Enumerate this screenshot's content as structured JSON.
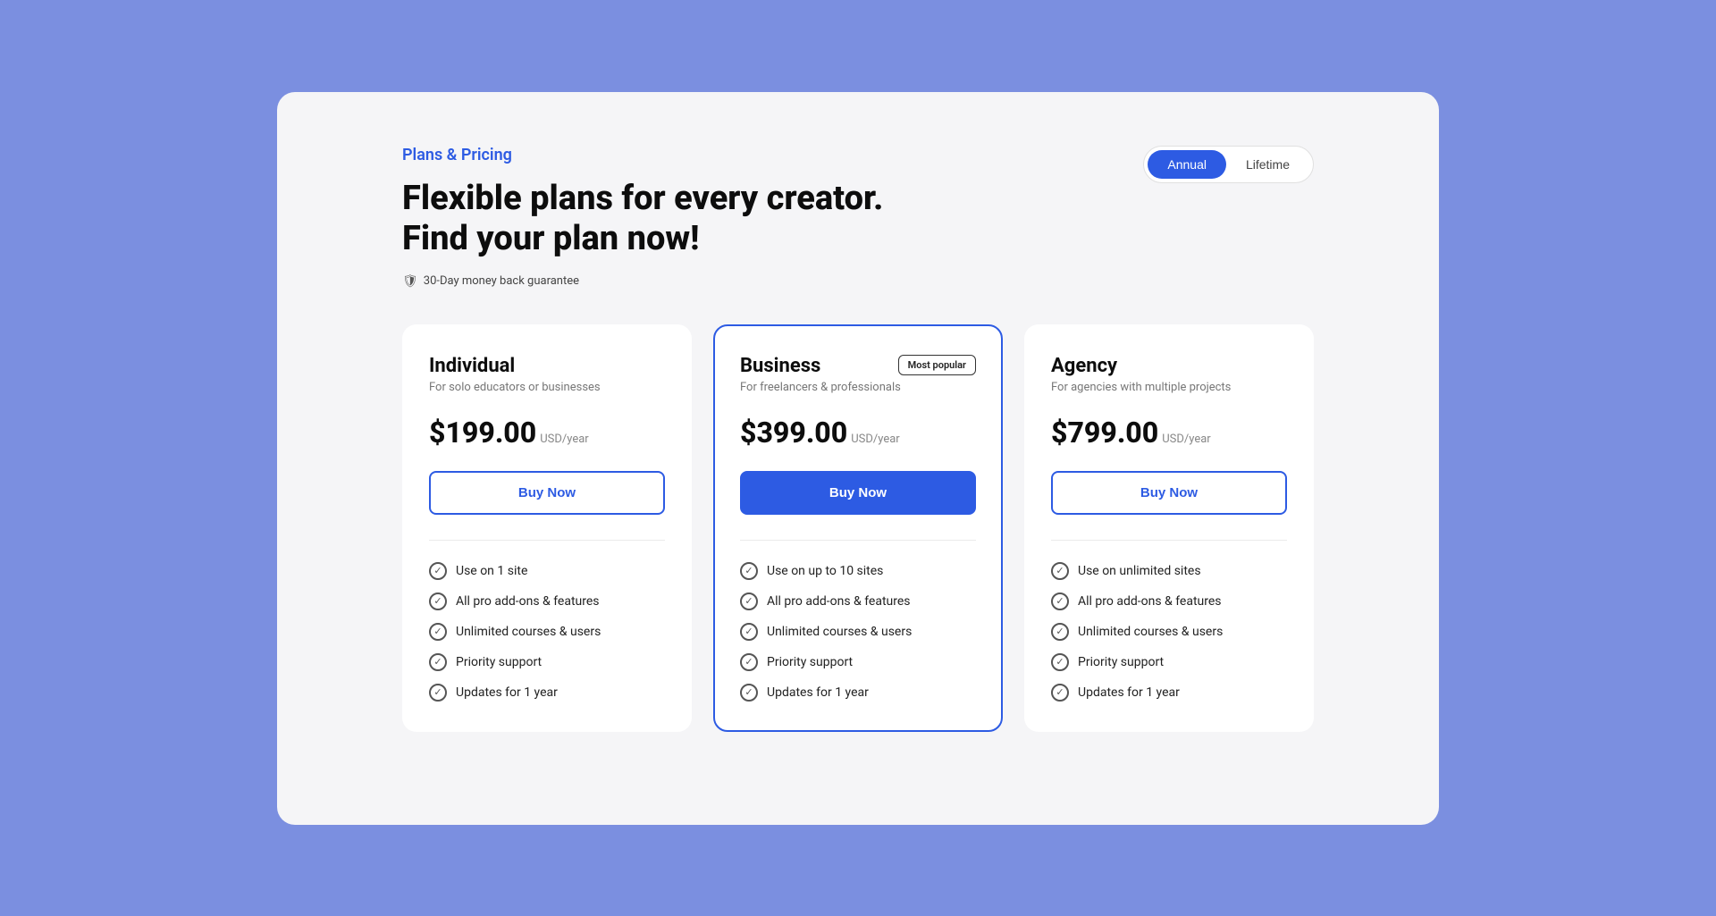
{
  "page": {
    "background_color": "#7b8fe0",
    "card_background": "#f5f5f7"
  },
  "header": {
    "section_label": "Plans & Pricing",
    "headline_line1": "Flexible plans for every creator.",
    "headline_line2": "Find your plan now!",
    "guarantee_text": "30-Day money back guarantee"
  },
  "billing_toggle": {
    "annual_label": "Annual",
    "lifetime_label": "Lifetime",
    "active": "annual"
  },
  "plans": [
    {
      "id": "individual",
      "name": "Individual",
      "description": "For solo educators or businesses",
      "price": "$199.00",
      "period": "USD/year",
      "buy_label": "Buy Now",
      "is_featured": false,
      "is_popular": false,
      "features": [
        "Use on 1 site",
        "All pro add-ons & features",
        "Unlimited courses & users",
        "Priority support",
        "Updates for 1 year"
      ]
    },
    {
      "id": "business",
      "name": "Business",
      "description": "For freelancers & professionals",
      "price": "$399.00",
      "period": "USD/year",
      "buy_label": "Buy Now",
      "is_featured": true,
      "is_popular": true,
      "popular_badge": "Most popular",
      "features": [
        "Use on up to 10 sites",
        "All pro add-ons & features",
        "Unlimited courses & users",
        "Priority support",
        "Updates for 1 year"
      ]
    },
    {
      "id": "agency",
      "name": "Agency",
      "description": "For agencies with multiple projects",
      "price": "$799.00",
      "period": "USD/year",
      "buy_label": "Buy Now",
      "is_featured": false,
      "is_popular": false,
      "features": [
        "Use on unlimited sites",
        "All pro add-ons & features",
        "Unlimited courses & users",
        "Priority support",
        "Updates for 1 year"
      ]
    }
  ]
}
